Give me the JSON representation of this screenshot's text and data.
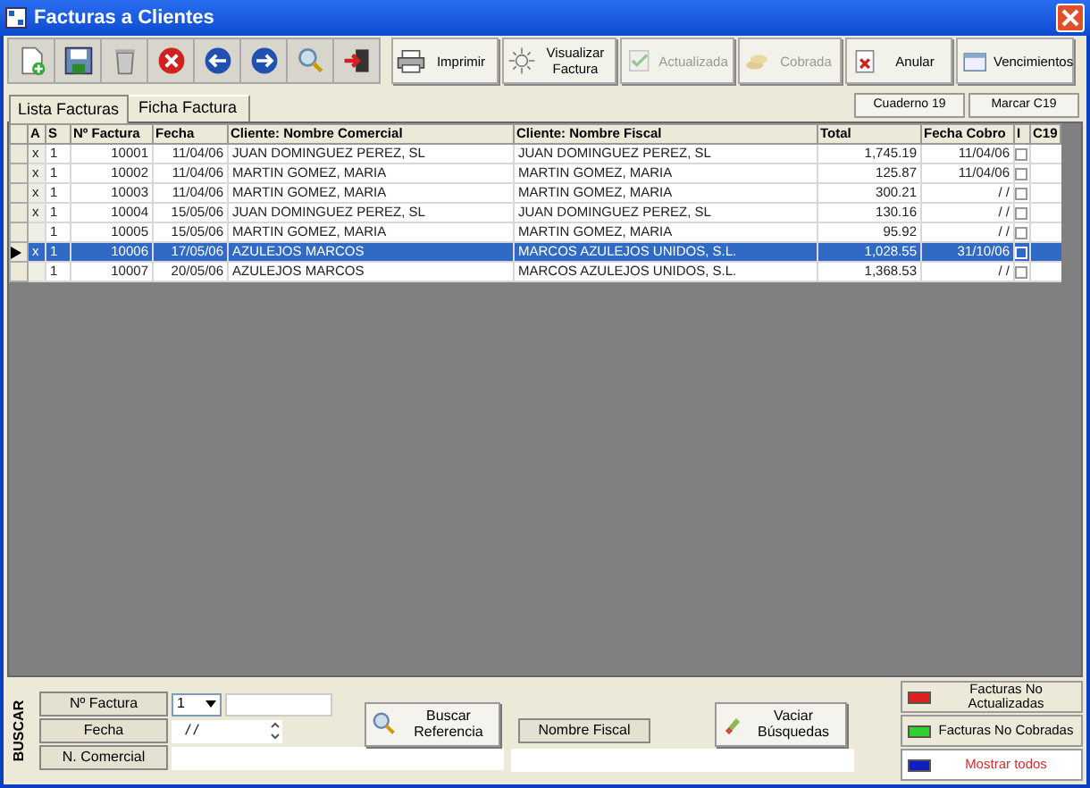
{
  "window": {
    "title": "Facturas a Clientes"
  },
  "toolbar": {
    "icon_buttons": [
      {
        "kind": "new"
      },
      {
        "kind": "save"
      },
      {
        "kind": "delete"
      },
      {
        "kind": "cancel"
      },
      {
        "kind": "back"
      },
      {
        "kind": "forward"
      },
      {
        "kind": "search"
      },
      {
        "kind": "exit"
      }
    ],
    "buttons": [
      {
        "kind": "print",
        "label": "Imprimir",
        "disabled": false
      },
      {
        "kind": "view",
        "label": "Visualizar Factura",
        "disabled": false
      },
      {
        "kind": "check",
        "label": "Actualizada",
        "disabled": true
      },
      {
        "kind": "coins",
        "label": "Cobrada",
        "disabled": true
      },
      {
        "kind": "cancel-doc",
        "label": "Anular",
        "disabled": false
      },
      {
        "kind": "calendar",
        "label": "Vencimientos",
        "disabled": false
      }
    ]
  },
  "tabs": [
    {
      "label": "Lista Facturas",
      "selected": true
    },
    {
      "label": "Ficha Factura",
      "selected": false
    }
  ],
  "action_buttons": [
    "Cuaderno 19",
    "Marcar C19"
  ],
  "table": {
    "columns": [
      "A",
      "S",
      "Nº Factura",
      "Fecha",
      "Cliente: Nombre Comercial",
      "Cliente: Nombre Fiscal",
      "Total",
      "Fecha Cobro",
      "I",
      "C19"
    ],
    "rows": [
      {
        "a": "x",
        "s": "1",
        "numero": "10001",
        "fecha": "11/04/06",
        "comercial": "JUAN DOMINGUEZ PEREZ, SL",
        "fiscal": "JUAN DOMINGUEZ PEREZ, SL",
        "total": "1,745.19",
        "fecha_cobro": "11/04/06",
        "checked": false,
        "selected": false
      },
      {
        "a": "x",
        "s": "1",
        "numero": "10002",
        "fecha": "11/04/06",
        "comercial": "MARTIN GOMEZ, MARIA",
        "fiscal": "MARTIN GOMEZ, MARIA",
        "total": "125.87",
        "fecha_cobro": "11/04/06",
        "checked": false,
        "selected": false
      },
      {
        "a": "x",
        "s": "1",
        "numero": "10003",
        "fecha": "11/04/06",
        "comercial": "MARTIN GOMEZ, MARIA",
        "fiscal": "MARTIN GOMEZ, MARIA",
        "total": "300.21",
        "fecha_cobro": "/ /",
        "checked": false,
        "selected": false
      },
      {
        "a": "x",
        "s": "1",
        "numero": "10004",
        "fecha": "15/05/06",
        "comercial": "JUAN DOMINGUEZ PEREZ, SL",
        "fiscal": "JUAN DOMINGUEZ PEREZ, SL",
        "total": "130.16",
        "fecha_cobro": "/ /",
        "checked": false,
        "selected": false
      },
      {
        "a": "",
        "s": "1",
        "numero": "10005",
        "fecha": "15/05/06",
        "comercial": "MARTIN GOMEZ, MARIA",
        "fiscal": "MARTIN GOMEZ, MARIA",
        "total": "95.92",
        "fecha_cobro": "/ /",
        "checked": false,
        "selected": false
      },
      {
        "a": "x",
        "s": "1",
        "numero": "10006",
        "fecha": "17/05/06",
        "comercial": "AZULEJOS MARCOS",
        "fiscal": "MARCOS AZULEJOS UNIDOS, S.L.",
        "total": "1,028.55",
        "fecha_cobro": "31/10/06",
        "checked": false,
        "selected": true
      },
      {
        "a": "",
        "s": "1",
        "numero": "10007",
        "fecha": "20/05/06",
        "comercial": "AZULEJOS MARCOS",
        "fiscal": "MARCOS AZULEJOS UNIDOS, S.L.",
        "total": "1,368.53",
        "fecha_cobro": "/ /",
        "checked": false,
        "selected": false
      }
    ]
  },
  "search": {
    "title": "BUSCAR",
    "factura_label": "Nº Factura",
    "factura_value": "1",
    "fecha_label": "Fecha",
    "fecha_value": "/ /",
    "comercial_label": "N. Comercial",
    "buscar_button": "Buscar Referencia",
    "fiscal_label": "Nombre Fiscal",
    "vaciar_button": "Vaciar Búsquedas"
  },
  "filters": [
    {
      "label": "Facturas No Actualizadas",
      "color": "#e02020",
      "selected": false
    },
    {
      "label": "Facturas No Cobradas",
      "color": "#30d030",
      "selected": false
    },
    {
      "label": "Mostrar todos",
      "color": "#1020c0",
      "selected": true
    }
  ]
}
